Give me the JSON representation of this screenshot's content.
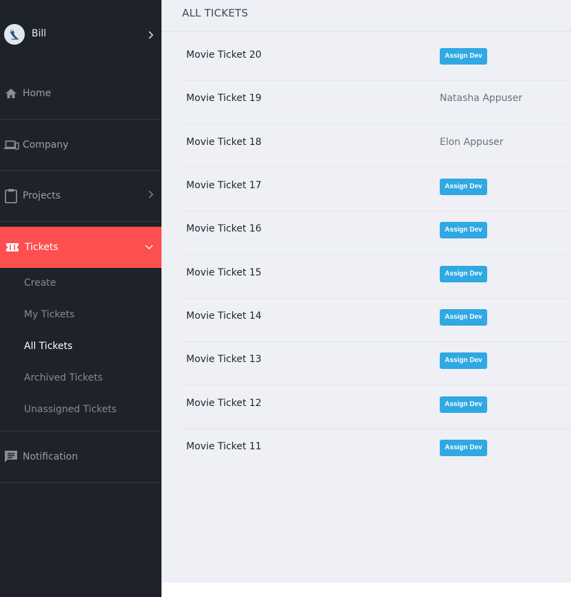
{
  "user": {
    "name": "Bill"
  },
  "sidebar": {
    "home": "Home",
    "company": "Company",
    "projects": "Projects",
    "tickets": "Tickets",
    "ticket_sub": [
      "Create",
      "My Tickets",
      "All Tickets",
      "Archived Tickets",
      "Unassigned Tickets"
    ],
    "notification": "Notification"
  },
  "main": {
    "title": "ALL TICKETS",
    "assign_label": "Assign Dev",
    "tickets": [
      {
        "name": "Movie Ticket 20",
        "dev": null
      },
      {
        "name": "Movie Ticket 19",
        "dev": "Natasha Appuser"
      },
      {
        "name": "Movie Ticket 18",
        "dev": "Elon Appuser"
      },
      {
        "name": "Movie Ticket 17",
        "dev": null
      },
      {
        "name": "Movie Ticket 16",
        "dev": null
      },
      {
        "name": "Movie Ticket 15",
        "dev": null
      },
      {
        "name": "Movie Ticket 14",
        "dev": null
      },
      {
        "name": "Movie Ticket 13",
        "dev": null
      },
      {
        "name": "Movie Ticket 12",
        "dev": null
      },
      {
        "name": "Movie Ticket 11",
        "dev": null
      }
    ]
  },
  "colors": {
    "sidebar_bg": "#1e2229",
    "active_accent": "#fd4f4f",
    "button_blue": "#2fa8e3",
    "content_bg": "#eef0f5"
  },
  "icons": {
    "home": "home-icon",
    "company": "devices-icon",
    "projects": "clipboard-icon",
    "tickets": "ticket-icon",
    "notification": "message-icon",
    "user_expand": "chevron-right-icon",
    "projects_expand": "chevron-right-icon",
    "tickets_expand": "chevron-down-icon"
  }
}
